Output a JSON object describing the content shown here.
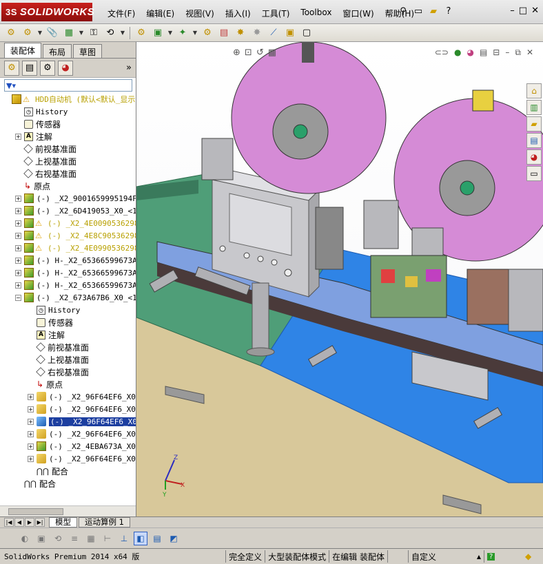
{
  "app": {
    "logo": "SOLIDWORKS",
    "menu": [
      "文件(F)",
      "编辑(E)",
      "视图(V)",
      "插入(I)",
      "工具(T)",
      "Toolbox",
      "窗口(W)",
      "帮助(H)"
    ],
    "window_buttons": [
      "–",
      "□",
      "✕"
    ]
  },
  "left_panel": {
    "tabs": [
      "装配体",
      "布局",
      "草图"
    ],
    "tree": [
      {
        "label": "HDD自动机  (默认<默认_显示",
        "icon": "assembly-warning-icon",
        "indent": 0,
        "exp": "",
        "style": "yellow"
      },
      {
        "label": "History",
        "icon": "history-icon",
        "indent": 1,
        "exp": "",
        "style": ""
      },
      {
        "label": "传感器",
        "icon": "sensor-icon",
        "indent": 1,
        "exp": "",
        "style": "cn"
      },
      {
        "label": "注解",
        "icon": "annotation-icon",
        "indent": 1,
        "exp": "+",
        "style": "cn"
      },
      {
        "label": "前视基准面",
        "icon": "plane-icon",
        "indent": 1,
        "exp": "",
        "style": "cn"
      },
      {
        "label": "上视基准面",
        "icon": "plane-icon",
        "indent": 1,
        "exp": "",
        "style": "cn"
      },
      {
        "label": "右视基准面",
        "icon": "plane-icon",
        "indent": 1,
        "exp": "",
        "style": "cn"
      },
      {
        "label": "原点",
        "icon": "origin-icon",
        "indent": 1,
        "exp": "",
        "style": "cn"
      },
      {
        "label": "(-) _X2_9001659995194F4D_",
        "icon": "subassembly-icon",
        "indent": 1,
        "exp": "+",
        "style": ""
      },
      {
        "label": "(-) _X2_6D419053_X0_<1> (",
        "icon": "subassembly-icon",
        "indent": 1,
        "exp": "+",
        "style": ""
      },
      {
        "label": "(-) _X2_4E00905362985F2",
        "icon": "subassembly-warning-icon",
        "indent": 1,
        "exp": "+",
        "style": "yellow"
      },
      {
        "label": "(-) _X2_4E8C905362985F2",
        "icon": "subassembly-warning-icon",
        "indent": 1,
        "exp": "+",
        "style": "yellow"
      },
      {
        "label": "(-) _X2_4E09905362985F2",
        "icon": "subassembly-warning-icon",
        "indent": 1,
        "exp": "+",
        "style": "yellow"
      },
      {
        "label": "(-) H-_X2_65366599673A678",
        "icon": "subassembly-icon",
        "indent": 1,
        "exp": "+",
        "style": ""
      },
      {
        "label": "(-) H-_X2_65366599673A678",
        "icon": "subassembly-icon",
        "indent": 1,
        "exp": "+",
        "style": ""
      },
      {
        "label": "(-) H-_X2_65366599673A678",
        "icon": "subassembly-icon",
        "indent": 1,
        "exp": "+",
        "style": ""
      },
      {
        "label": "(-) _X2_673A67B6_X0_<1> (",
        "icon": "subassembly-icon",
        "indent": 1,
        "exp": "−",
        "style": ""
      },
      {
        "label": "History",
        "icon": "history-icon",
        "indent": 2,
        "exp": "",
        "style": ""
      },
      {
        "label": "传感器",
        "icon": "sensor-icon",
        "indent": 2,
        "exp": "",
        "style": "cn"
      },
      {
        "label": "注解",
        "icon": "annotation-icon",
        "indent": 2,
        "exp": "",
        "style": "cn"
      },
      {
        "label": "前视基准面",
        "icon": "plane-icon",
        "indent": 2,
        "exp": "",
        "style": "cn"
      },
      {
        "label": "上视基准面",
        "icon": "plane-icon",
        "indent": 2,
        "exp": "",
        "style": "cn"
      },
      {
        "label": "右视基准面",
        "icon": "plane-icon",
        "indent": 2,
        "exp": "",
        "style": "cn"
      },
      {
        "label": "原点",
        "icon": "origin-icon",
        "indent": 2,
        "exp": "",
        "style": "cn"
      },
      {
        "label": "(-) _X2_96F64EF6_X0_15",
        "icon": "part-icon",
        "indent": 2,
        "exp": "+",
        "style": ""
      },
      {
        "label": "(-) _X2_96F64EF6_X0_16",
        "icon": "part-icon",
        "indent": 2,
        "exp": "+",
        "style": ""
      },
      {
        "label": "(-) _X2_96F64EF6_X0_14",
        "icon": "part-blue-icon",
        "indent": 2,
        "exp": "+",
        "style": "selected"
      },
      {
        "label": "(-) _X2_96F64EF6_X0_16",
        "icon": "part-icon",
        "indent": 2,
        "exp": "+",
        "style": ""
      },
      {
        "label": "(-) _X2_4EBA673A_X0_<1",
        "icon": "subassembly-icon",
        "indent": 2,
        "exp": "+",
        "style": ""
      },
      {
        "label": "(-) _X2_96F64EF6_X0_16",
        "icon": "part-icon",
        "indent": 2,
        "exp": "+",
        "style": ""
      },
      {
        "label": "配合",
        "icon": "mates-icon",
        "indent": 2,
        "exp": "",
        "style": "cn"
      },
      {
        "label": "配合",
        "icon": "mates-icon",
        "indent": 1,
        "exp": "",
        "style": "cn"
      }
    ]
  },
  "bottom_tabs": [
    "模型",
    "运动算例 1"
  ],
  "statusbar": {
    "product": "SolidWorks Premium 2014 x64 版",
    "fully_defined": "完全定义",
    "large_mode": "大型装配体模式",
    "editing": "在编辑 装配体",
    "units": "自定义"
  },
  "colors": {
    "title_red": "#b0161a",
    "selection_blue": "#1c3ea0",
    "warning_yellow": "#b8a000"
  }
}
